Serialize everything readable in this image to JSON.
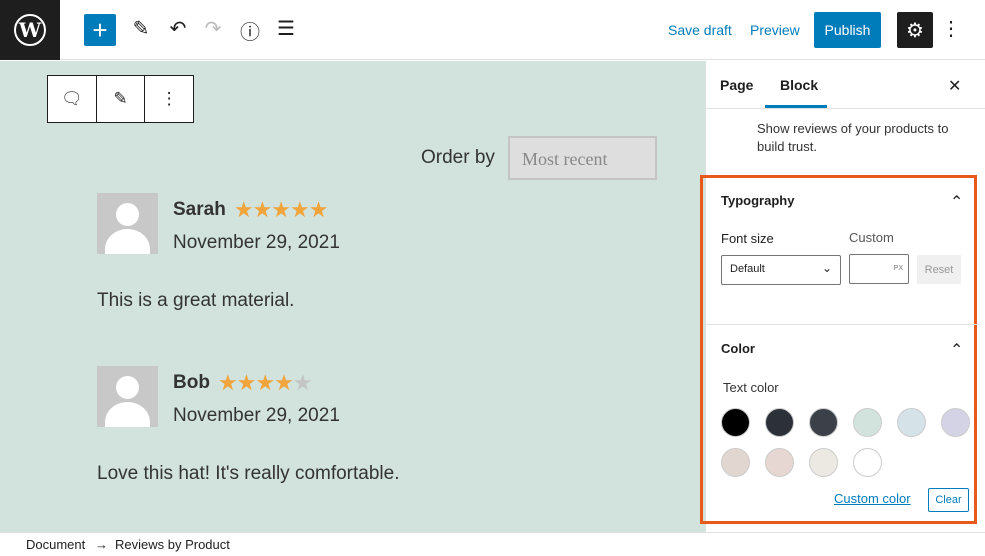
{
  "topbar": {
    "logo": "W",
    "add": "+",
    "edit_icon": "✎",
    "undo_icon": "↶",
    "redo_icon": "↷",
    "info_icon": "ⓘ",
    "list_icon": "☰",
    "save_draft": "Save draft",
    "preview": "Preview",
    "publish": "Publish",
    "settings_icon": "⚙",
    "more_icon": "⋮"
  },
  "block_toolbar": {
    "comment_icon": "🗨",
    "pen_icon": "✎",
    "more_icon": "⋮"
  },
  "content": {
    "order_by_label": "Order by",
    "order_by_value": "Most recent",
    "reviews": [
      {
        "name": "Sarah",
        "rating": 5,
        "stars_filled": "★★★★★",
        "stars_empty": "",
        "date": "November 29, 2021",
        "text": "This is a great material."
      },
      {
        "name": "Bob",
        "rating": 4,
        "stars_filled": "★★★★",
        "stars_empty": "★",
        "date": "November 29, 2021",
        "text": "Love this hat! It's really comfortable."
      }
    ]
  },
  "sidebar": {
    "tabs": [
      "Page",
      "Block"
    ],
    "close": "✕",
    "description": "Show reviews of your products to build trust.",
    "typography": {
      "title": "Typography",
      "chevron": "⌃",
      "font_size_label": "Font size",
      "font_size_value": "Default",
      "custom_label": "Custom",
      "unit": "PX",
      "reset": "Reset"
    },
    "color": {
      "title": "Color",
      "chevron": "⌃",
      "text_color_label": "Text color",
      "swatches": [
        "#000000",
        "#2c3039",
        "#3c4048",
        "#d2e3dd",
        "#d5e3e8",
        "#d3d3e5",
        "#e2d6d1",
        "#e6d7d2",
        "#ece9e3",
        "#ffffff"
      ],
      "custom_color": "Custom color",
      "clear": "Clear"
    }
  },
  "footer": {
    "breadcrumb": [
      "Document",
      "Reviews by Product"
    ],
    "separator": "→"
  },
  "colors": {
    "accent": "#007cba",
    "star": "#f0a43c",
    "highlight": "#e8591a"
  }
}
